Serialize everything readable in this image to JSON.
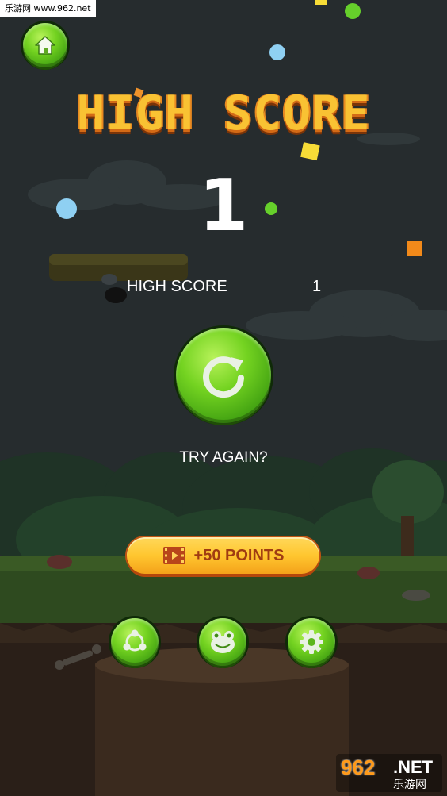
{
  "watermark": {
    "text": "乐游网 www.962.net"
  },
  "title": "HIGH SCORE",
  "score": "1",
  "high_score": {
    "label": "HIGH SCORE",
    "value": "1"
  },
  "retry": {
    "label": "TRY AGAIN?"
  },
  "reward_button": {
    "label": "+50 POINTS"
  },
  "bottom_buttons": [
    "share",
    "frog-character",
    "settings"
  ],
  "corner_logo": {
    "num": "962",
    "suffix": ".NET",
    "cn": "乐游网"
  },
  "colors": {
    "button_green": "#74d321",
    "title_yellow": "#f9c233",
    "title_orange": "#d36a16",
    "reward_yellow": "#ffc62f",
    "background": "#262c2e"
  }
}
